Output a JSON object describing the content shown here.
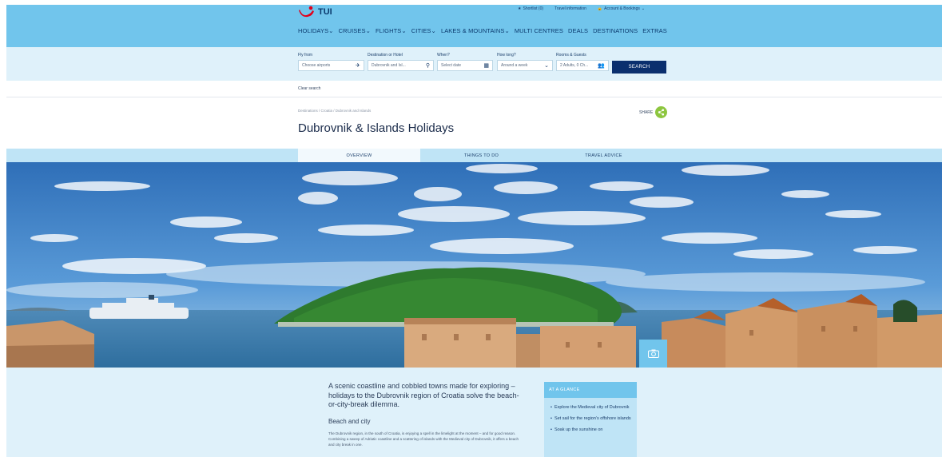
{
  "brand": {
    "name": "TUI"
  },
  "utility": {
    "shortlist": "Shortlist (0)",
    "travel_info": "Travel information",
    "account": "Account & Bookings"
  },
  "nav": [
    "HOLIDAYS",
    "CRUISES",
    "FLIGHTS",
    "CITIES",
    "LAKES & MOUNTAINS",
    "MULTI CENTRES",
    "DEALS",
    "DESTINATIONS",
    "EXTRAS"
  ],
  "search": {
    "fly_from": {
      "label": "Fly from",
      "value": "Choose airports"
    },
    "destination": {
      "label": "Destination or Hotel",
      "value": "Dubrovnik and Isl..."
    },
    "when": {
      "label": "When?",
      "value": "Select date"
    },
    "duration": {
      "label": "How long?",
      "value": "Around a week"
    },
    "rooms": {
      "label": "Rooms & Guests",
      "value": "2 Adults, 0 Ch..."
    },
    "search_button": "SEARCH",
    "clear": "Clear search"
  },
  "breadcrumb": "Destinations / Croatia / Dubrovnik and Islands",
  "page_title": "Dubrovnik & Islands Holidays",
  "share_label": "SHARE",
  "tabs": [
    {
      "label": "OVERVIEW",
      "active": true
    },
    {
      "label": "THINGS TO DO",
      "active": false
    },
    {
      "label": "TRAVEL ADVICE",
      "active": false
    }
  ],
  "intro": "A scenic coastline and cobbled towns made for exploring – holidays to the Dubrovnik region of Croatia solve the beach-or-city-break dilemma.",
  "section_heading": "Beach and city",
  "section_body": "The Dubrovnik region, in the south of Croatia, is enjoying a spell in the limelight at the moment – and for good reason. Combining a sweep of Adriatic coastline and a scattering of islands with the Medieval city of Dubrovnik, it offers a beach and city break in one.",
  "glance": {
    "heading": "AT A GLANCE",
    "items": [
      "Explore the Medieval city of Dubrovnik",
      "Set sail for the region's offshore islands",
      "Soak up the sunshine on"
    ]
  },
  "colors": {
    "header": "#71c5ec",
    "search_bg": "#dff1fa",
    "navy": "#0a2f6e",
    "tabs": "#bfe4f6",
    "share": "#8dc63f",
    "logo_red": "#e2001a"
  }
}
